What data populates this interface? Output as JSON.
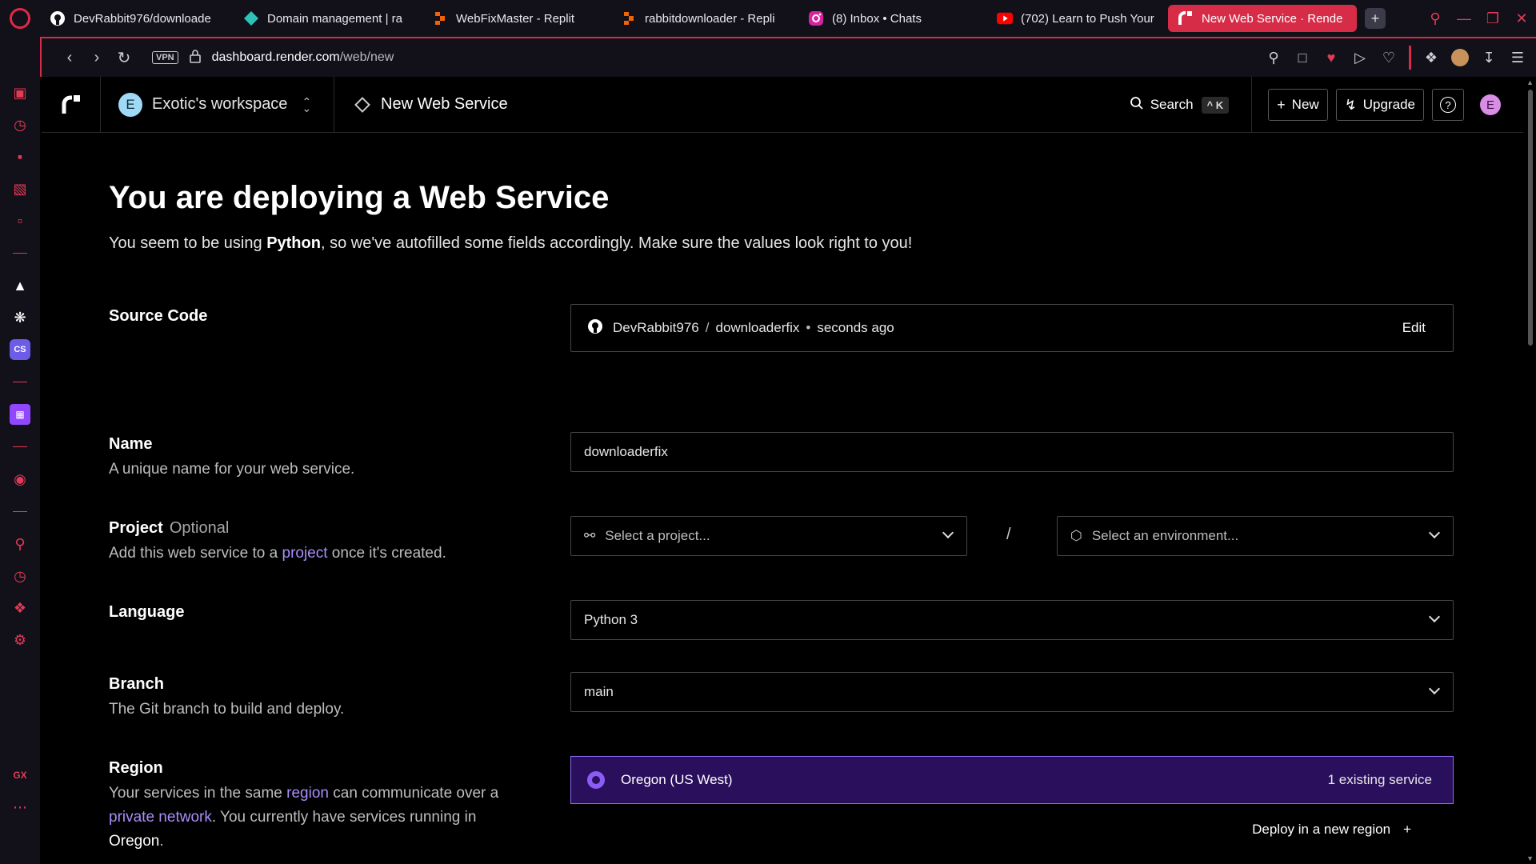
{
  "browser": {
    "tabs": [
      {
        "label": "DevRabbit976/downloade",
        "icon": "github-icon"
      },
      {
        "label": "Domain management | ra",
        "icon": "diamond-icon"
      },
      {
        "label": "WebFixMaster - Replit",
        "icon": "replit-icon"
      },
      {
        "label": "rabbitdownloader - Repli",
        "icon": "replit-icon"
      },
      {
        "label": "(8) Inbox • Chats",
        "icon": "instagram-icon"
      },
      {
        "label": "(702) Learn to Push Your",
        "icon": "youtube-icon"
      },
      {
        "label": "New Web Service · Rende",
        "icon": "render-icon",
        "active": true
      }
    ],
    "url_domain": "dashboard.render.com",
    "url_path": "/web/new",
    "vpn_label": "VPN",
    "sidebar_gx": "GX",
    "accent": "#d62c48"
  },
  "header": {
    "workspace_initial": "E",
    "workspace_name": "Exotic's workspace",
    "service_title": "New Web Service",
    "search_label": "Search",
    "search_shortcut": "^ K",
    "new_label": "New",
    "upgrade_label": "Upgrade",
    "help_symbol": "?",
    "user_initial": "E"
  },
  "page": {
    "title": "You are deploying a Web Service",
    "subtitle_prefix": "You seem to be using ",
    "subtitle_lang": "Python",
    "subtitle_suffix": ", so we've autofilled some fields accordingly. Make sure the values look right to you!"
  },
  "source": {
    "label": "Source Code",
    "owner": "DevRabbit976",
    "separator": "/",
    "repo": "downloaderfix",
    "dot": "•",
    "time": "seconds ago",
    "edit_label": "Edit"
  },
  "name": {
    "label": "Name",
    "desc": "A unique name for your web service.",
    "value": "downloaderfix"
  },
  "project": {
    "label": "Project",
    "optional": "Optional",
    "desc_prefix": "Add this web service to a ",
    "desc_link": "project",
    "desc_suffix": " once it's created.",
    "project_placeholder": "Select a project...",
    "slash": "/",
    "env_placeholder": "Select an environment..."
  },
  "language": {
    "label": "Language",
    "value": "Python 3"
  },
  "branch": {
    "label": "Branch",
    "desc": "The Git branch to build and deploy.",
    "value": "main"
  },
  "region": {
    "label": "Region",
    "desc_1": "Your services in the same ",
    "desc_link_1": "region",
    "desc_2": " can communicate over a ",
    "desc_link_2": "private network",
    "desc_3": ". You currently have services running in ",
    "desc_strong": "Oregon",
    "desc_4": ".",
    "selected_name": "Oregon (US West)",
    "selected_count": "1 existing service",
    "deploy_new_label": "Deploy in a new region",
    "deploy_new_icon": "+",
    "accent": "#8b5cf6"
  }
}
